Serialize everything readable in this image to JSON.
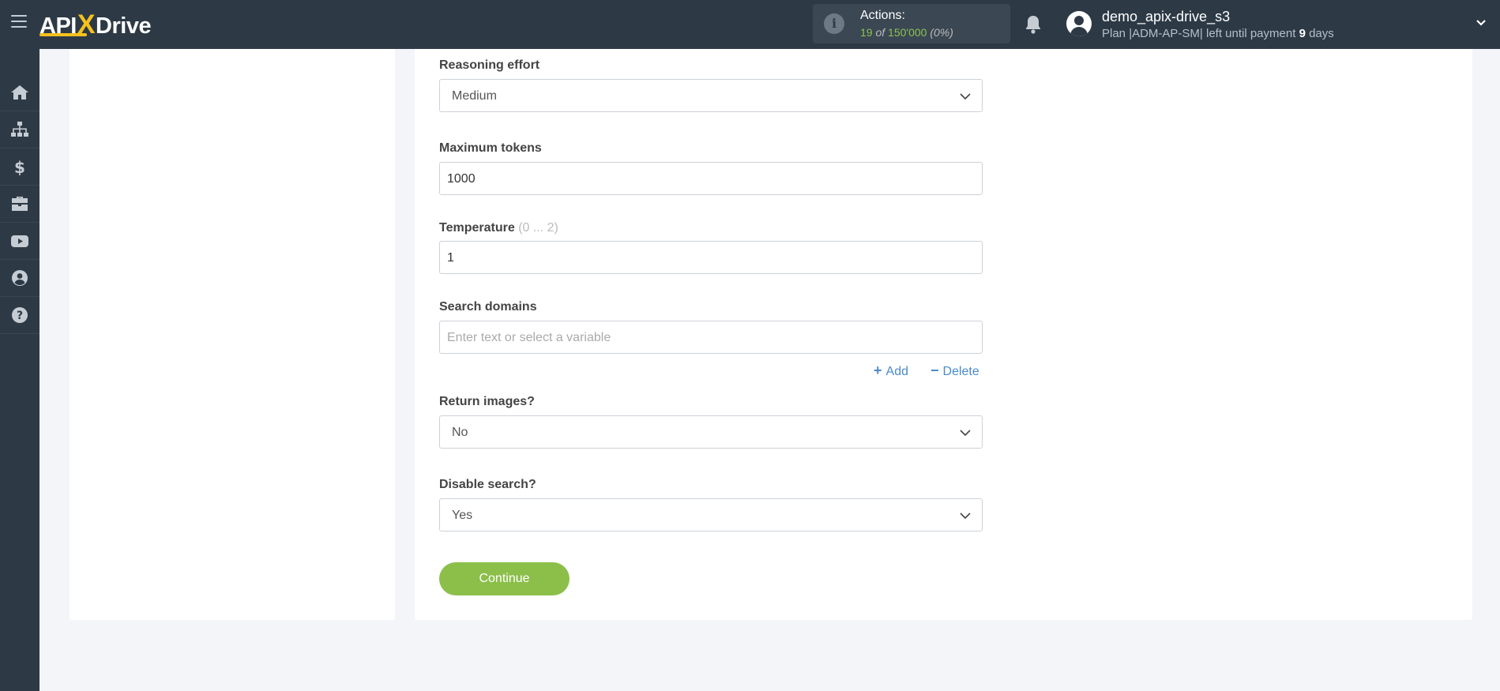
{
  "header": {
    "logo": {
      "part1": "API",
      "x": "X",
      "part2": "Drive"
    },
    "actions": {
      "label": "Actions:",
      "used": "19",
      "of": "of",
      "total": "150'000",
      "percent": "(0%)"
    },
    "user": {
      "name": "demo_apix-drive_s3",
      "plan_prefix": "Plan |ADM-AP-SM| left until payment",
      "days": "9",
      "days_suffix": "days"
    }
  },
  "sidebar": {
    "items": [
      {
        "icon": "home-icon"
      },
      {
        "icon": "sitemap-icon"
      },
      {
        "icon": "dollar-icon"
      },
      {
        "icon": "briefcase-icon"
      },
      {
        "icon": "video-icon"
      },
      {
        "icon": "user-circle-icon"
      },
      {
        "icon": "help-icon"
      }
    ]
  },
  "form": {
    "reasoning_effort": {
      "label": "Reasoning effort",
      "value": "Medium"
    },
    "max_tokens": {
      "label": "Maximum tokens",
      "value": "1000"
    },
    "temperature": {
      "label": "Temperature",
      "hint": "(0 ... 2)",
      "value": "1"
    },
    "search_domains": {
      "label": "Search domains",
      "placeholder": "Enter text or select a variable",
      "add_label": "Add",
      "delete_label": "Delete"
    },
    "return_images": {
      "label": "Return images?",
      "value": "No"
    },
    "disable_search": {
      "label": "Disable search?",
      "value": "Yes"
    },
    "continue_label": "Continue"
  },
  "colors": {
    "topbar": "#2d3a46",
    "accent_yellow": "#f6c11c",
    "accent_green": "#8cbf4a",
    "link_blue": "#4a8bc8"
  }
}
